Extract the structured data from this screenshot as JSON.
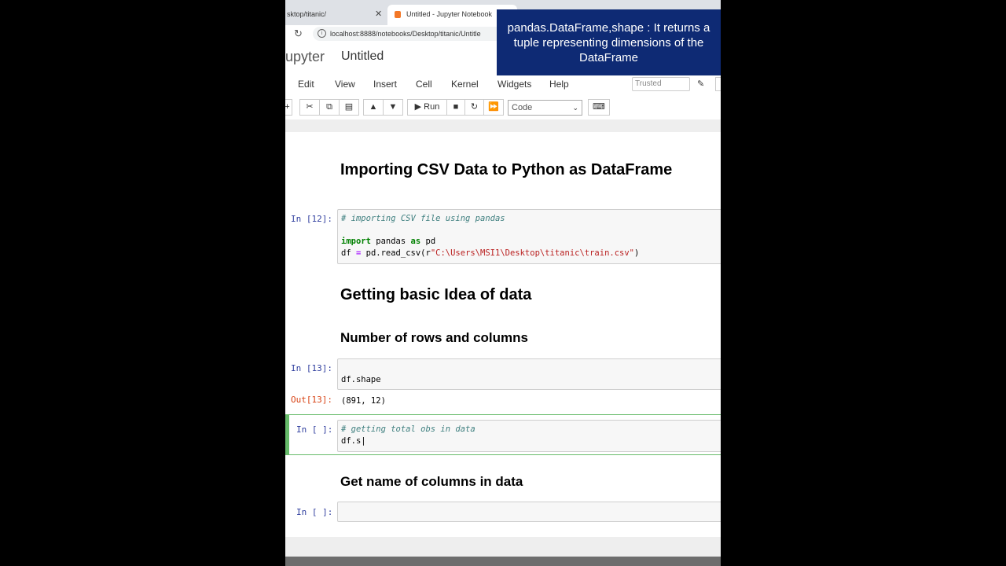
{
  "browser": {
    "tab1_title": "sktop/titanic/",
    "tab1_close": "✕",
    "tab2_title": "Untitled - Jupyter Notebook",
    "address": "localhost:8888/notebooks/Desktop/titanic/Untitle"
  },
  "jupyter": {
    "logo_text": "upyter",
    "notebook_title": "Untitled",
    "menu": [
      "Edit",
      "View",
      "Insert",
      "Cell",
      "Kernel",
      "Widgets",
      "Help"
    ],
    "trusted_label": "Trusted",
    "toolbar": {
      "run_label": "Run",
      "cell_type": "Code"
    }
  },
  "notebook": {
    "heading1": "Importing CSV Data to Python as DataFrame",
    "cell1": {
      "prompt": "In [12]:",
      "comment": "# importing CSV file using pandas",
      "line2_kw1": "import",
      "line2_mid": " pandas ",
      "line2_kw2": "as",
      "line2_end": " pd",
      "line3_start": "df ",
      "line3_eq": "=",
      "line3_mid": " pd.read_csv(r",
      "line3_str": "\"C:\\Users\\MSI1\\Desktop\\titanic\\train.csv\"",
      "line3_end": ")"
    },
    "heading2": "Getting basic Idea of data",
    "heading3": "Number of rows and columns",
    "cell2": {
      "prompt": "In [13]:",
      "code": "df.shape",
      "out_prompt": "Out[13]:",
      "output": "(891, 12)"
    },
    "cell3": {
      "prompt": "In [ ]:",
      "comment": "# getting total obs in data",
      "code": "df.s"
    },
    "heading4": "Get name of columns in data",
    "cell4": {
      "prompt": "In [ ]:"
    }
  },
  "overlay": {
    "caption": "pandas.DataFrame,shape : It returns a tuple representing dimensions of the DataFrame"
  },
  "colors": {
    "caption_bg": "#0e2a74",
    "selected_cell": "#66bb6a",
    "out_prompt": "#d84315",
    "in_prompt": "#303f9f"
  }
}
